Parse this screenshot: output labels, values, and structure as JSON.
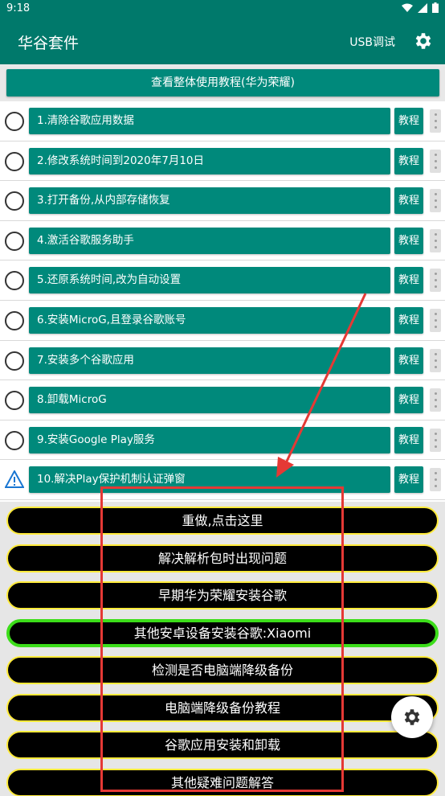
{
  "status_bar": {
    "time": "9:18"
  },
  "app_bar": {
    "title": "华谷套件",
    "usb_debug": "USB调试"
  },
  "tutorial_button": "查看整体使用教程(华为荣耀)",
  "steps": [
    {
      "label": "1.清除谷歌应用数据",
      "tutorial": "教程",
      "status": "unchecked"
    },
    {
      "label": "2.修改系统时间到2020年7月10日",
      "tutorial": "教程",
      "status": "unchecked"
    },
    {
      "label": "3.打开备份,从内部存储恢复",
      "tutorial": "教程",
      "status": "unchecked"
    },
    {
      "label": "4.激活谷歌服务助手",
      "tutorial": "教程",
      "status": "unchecked"
    },
    {
      "label": "5.还原系统时间,改为自动设置",
      "tutorial": "教程",
      "status": "unchecked"
    },
    {
      "label": "6.安装MicroG,且登录谷歌账号",
      "tutorial": "教程",
      "status": "unchecked"
    },
    {
      "label": "7.安装多个谷歌应用",
      "tutorial": "教程",
      "status": "unchecked"
    },
    {
      "label": "8.卸载MicroG",
      "tutorial": "教程",
      "status": "unchecked"
    },
    {
      "label": "9.安装Google Play服务",
      "tutorial": "教程",
      "status": "unchecked"
    },
    {
      "label": "10.解决Play保护机制认证弹窗",
      "tutorial": "教程",
      "status": "warning"
    }
  ],
  "actions": [
    {
      "label": "重做,点击这里",
      "highlight": "yellow"
    },
    {
      "label": "解决解析包时出现问题",
      "highlight": "yellow"
    },
    {
      "label": "早期华为荣耀安装谷歌",
      "highlight": "yellow"
    },
    {
      "label": "其他安卓设备安装谷歌:Xiaomi",
      "highlight": "green"
    },
    {
      "label": "检测是否电脑端降级备份",
      "highlight": "yellow"
    },
    {
      "label": "电脑端降级备份教程",
      "highlight": "yellow"
    },
    {
      "label": "谷歌应用安装和卸载",
      "highlight": "yellow"
    },
    {
      "label": "其他疑难问题解答",
      "highlight": "yellow"
    }
  ],
  "colors": {
    "primary": "#00796b",
    "button": "#00897b",
    "pill_border": "#ffeb3b",
    "pill_active_border": "#3cdd1a",
    "annotation": "#e53935"
  }
}
